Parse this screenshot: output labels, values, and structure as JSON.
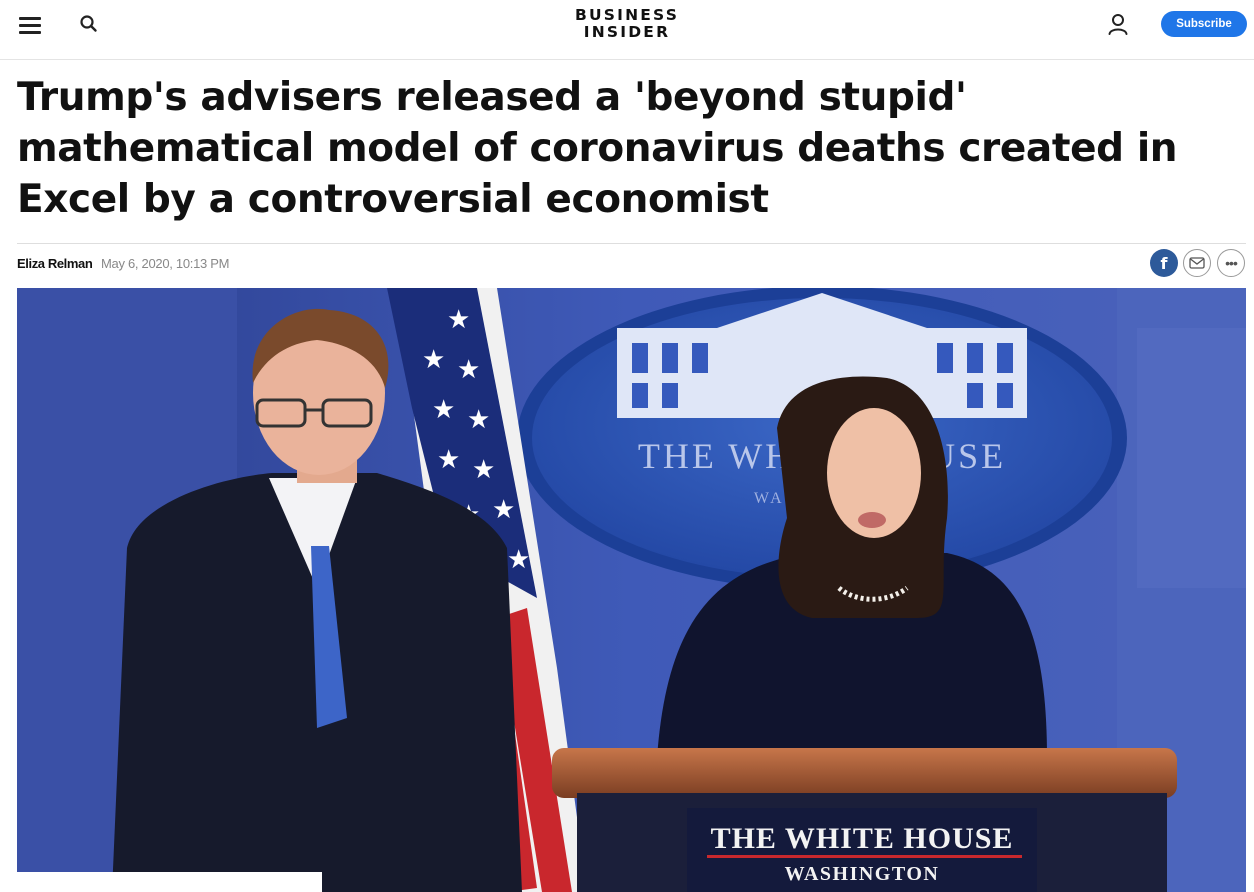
{
  "header": {
    "logo_line1": "BUSINESS",
    "logo_line2": "INSIDER",
    "subscribe_label": "Subscribe",
    "menu_icon": "hamburger-menu-icon",
    "search_icon": "search-icon",
    "account_icon": "user-account-icon"
  },
  "article": {
    "headline": "Trump's advisers released a 'beyond stupid' mathematical model of coronavirus deaths created in Excel by a controversial economist",
    "author": "Eliza Relman",
    "date": "May 6, 2020, 10:13 PM"
  },
  "share": {
    "facebook_glyph": "f",
    "more_glyph": "•••",
    "icons": [
      "facebook-icon",
      "email-icon",
      "more-options-icon"
    ]
  },
  "photo": {
    "seal_text": "THE WHITE HOUSE",
    "seal_sub": "WASHINGTON",
    "podium_text": "THE WHITE HOUSE",
    "podium_sub": "WASHINGTON"
  },
  "colors": {
    "subscribe_bg": "#1f76e8",
    "facebook": "#2d5a9a",
    "backdrop_blue": "#3d55b0"
  }
}
